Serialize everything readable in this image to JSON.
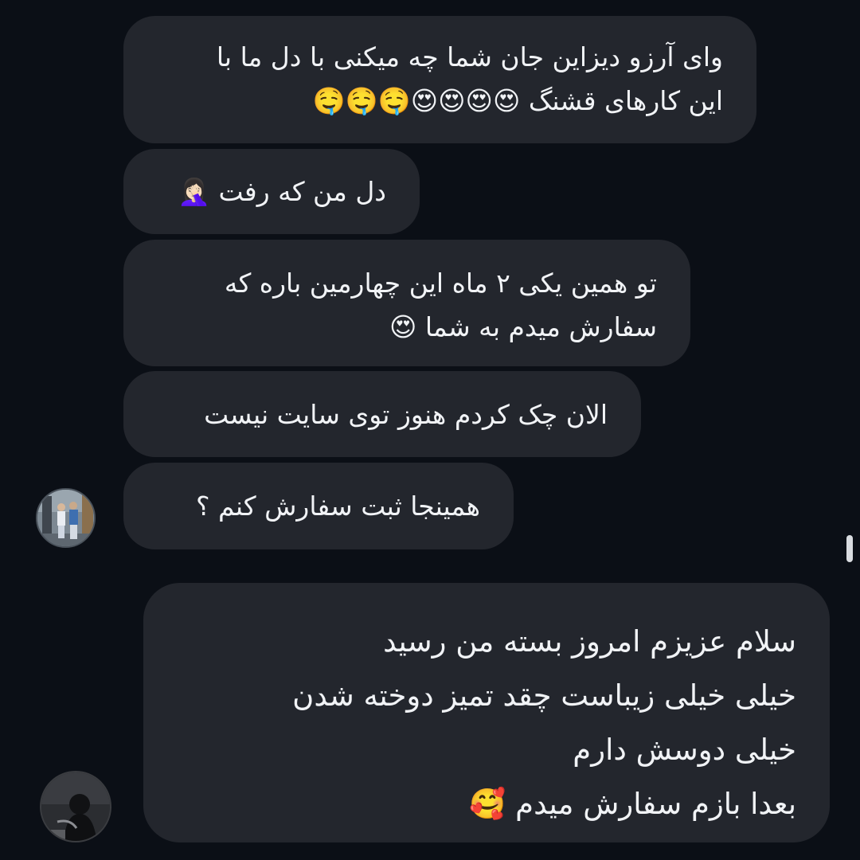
{
  "messages": [
    {
      "text": "وای آرزو دیزاین جان شما چه میکنی با دل ما با\nاین کارهای قشنگ 😍😍😍😍🤤🤤🤤"
    },
    {
      "text": "دل من که رفت 🤦🏻‍♀️"
    },
    {
      "text": "تو همین یکی ۲ ماه این  چهارمین باره  که\nسفارش میدم به شما 😍"
    },
    {
      "text": "الان چک کردم هنوز توی سایت نیست"
    },
    {
      "text": "همینجا ثبت سفارش کنم ؟"
    },
    {
      "text": "سلام عزیزم امروز بسته من رسید\nخیلی خیلی زیباست چقد تمیز دوخته شدن\nخیلی دوسش دارم\nبعدا بازم سفارش میدم 🥰"
    }
  ],
  "colors": {
    "background": "#0b0f16",
    "bubble": "#23262d",
    "text": "#f1f3f6"
  }
}
